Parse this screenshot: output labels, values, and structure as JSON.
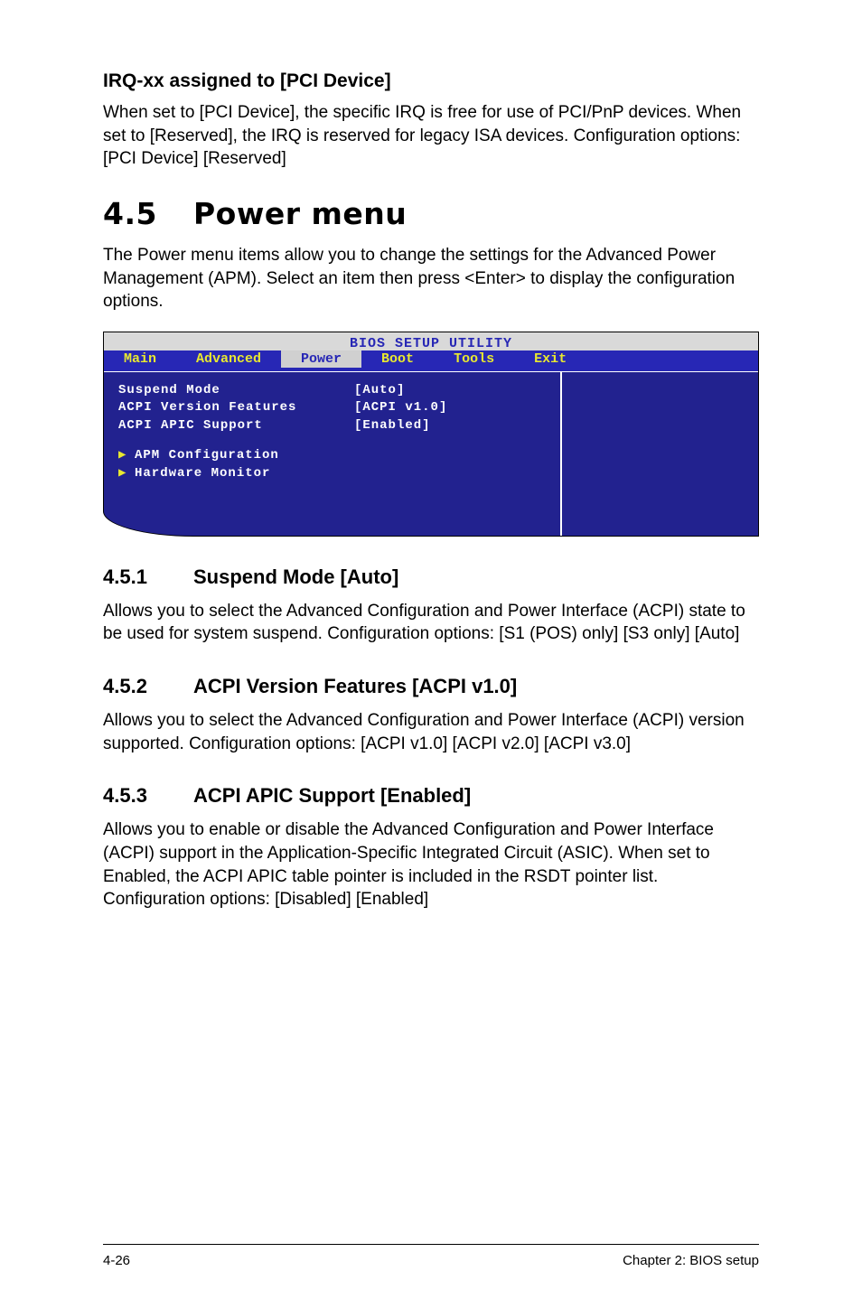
{
  "section_irq": {
    "heading": "IRQ-xx assigned to [PCI Device]",
    "body": "When set to [PCI Device], the specific IRQ is free for use of PCI/PnP devices. When set to [Reserved], the IRQ is reserved for legacy ISA devices. Configuration options: [PCI Device] [Reserved]"
  },
  "section_power": {
    "num": "4.5",
    "title": "Power menu",
    "intro": "The Power menu items allow you to change the settings for the Advanced Power Management (APM). Select an item then press <Enter> to display the configuration options."
  },
  "bios": {
    "header": "BIOS SETUP UTILITY",
    "tabs": {
      "main": "Main",
      "advanced": "Advanced",
      "power": "Power",
      "boot": "Boot",
      "tools": "Tools",
      "exit": "Exit"
    },
    "rows": {
      "suspend_label": "Suspend Mode",
      "suspend_val": "[Auto]",
      "acpi_ver_label": "ACPI Version Features",
      "acpi_ver_val": "[ACPI v1.0]",
      "acpi_apic_label": "ACPI APIC Support",
      "acpi_apic_val": "[Enabled]",
      "apm_label": "APM Configuration",
      "hw_label": "Hardware Monitor"
    }
  },
  "sub1": {
    "num": "4.5.1",
    "title": "Suspend Mode [Auto]",
    "body": "Allows you to select the Advanced Configuration and Power Interface (ACPI) state to be used for system suspend. Configuration options: [S1 (POS) only] [S3 only] [Auto]"
  },
  "sub2": {
    "num": "4.5.2",
    "title": "ACPI Version Features [ACPI v1.0]",
    "body": "Allows you to select the  Advanced Configuration and Power Interface (ACPI) version supported. Configuration options: [ACPI v1.0] [ACPI v2.0] [ACPI v3.0]"
  },
  "sub3": {
    "num": "4.5.3",
    "title": "ACPI APIC Support [Enabled]",
    "body": "Allows you to enable or disable the Advanced Configuration and Power Interface (ACPI) support in the Application-Specific Integrated Circuit (ASIC). When set to Enabled, the ACPI APIC table pointer is included in the RSDT pointer list. Configuration options: [Disabled] [Enabled]"
  },
  "footer": {
    "left": "4-26",
    "right": "Chapter 2: BIOS setup"
  }
}
